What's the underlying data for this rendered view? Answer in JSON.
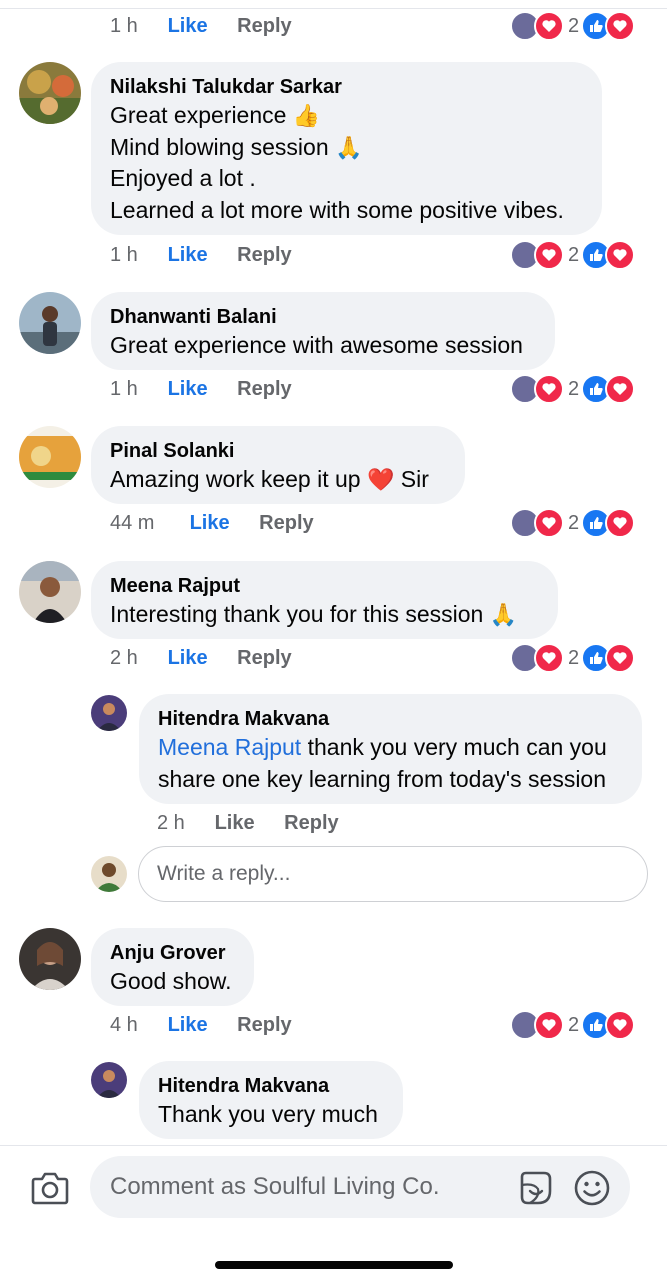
{
  "reaction_count": "2",
  "meta_labels": {
    "like": "Like",
    "reply": "Reply"
  },
  "top": {
    "time": "1 h"
  },
  "comments": [
    {
      "name": "Nilakshi Talukdar Sarkar",
      "lines": [
        "Great experience",
        "Mind blowing session",
        "Enjoyed a lot .",
        "Learned a lot more with some positive vibes."
      ],
      "time": "1 h"
    },
    {
      "name": "Dhanwanti Balani",
      "lines": [
        "Great experience with awesome session"
      ],
      "time": "1 h"
    },
    {
      "name": "Pinal Solanki",
      "lines": [
        "Amazing work keep it up",
        "Sir"
      ],
      "time": "44 m"
    },
    {
      "name": "Meena Rajput",
      "lines": [
        "Interesting thank you for this session"
      ],
      "time": "2 h"
    },
    {
      "name": "Anju Grover",
      "lines": [
        "Good show."
      ],
      "time": "4 h"
    }
  ],
  "replies": [
    {
      "name": "Hitendra Makvana",
      "mention": "Meena Rajput",
      "line1_rest": " thank you very much can you",
      "line2": "share one key learning from today's session",
      "time": "2 h"
    },
    {
      "name": "Hitendra Makvana",
      "text": "Thank you very much"
    }
  ],
  "reply_input": {
    "placeholder": "Write a reply..."
  },
  "comment_input": {
    "placeholder": "Comment as Soulful Living Co."
  },
  "colors": {
    "link": "#216fdb",
    "like_blue": "#1b74e4",
    "bubble": "#f0f2f5",
    "heart": "#f0284a"
  },
  "icons": [
    "camera-icon",
    "sticker-icon",
    "smiley-icon",
    "thumbs-up-emoji",
    "folded-hands-emoji",
    "red-heart-emoji"
  ]
}
